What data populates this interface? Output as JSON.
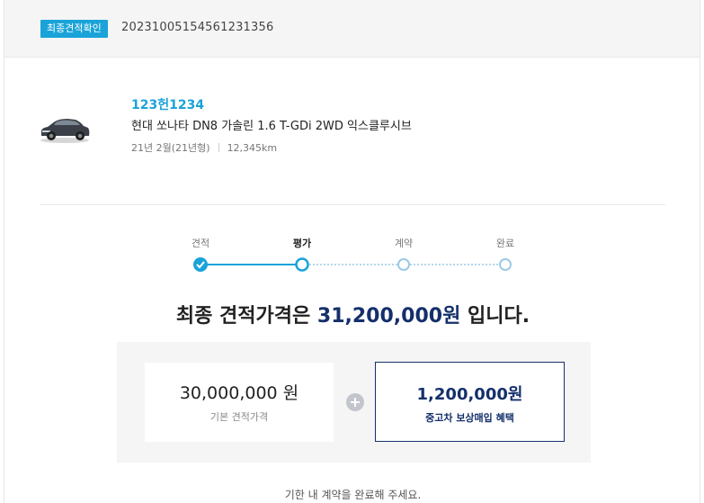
{
  "header": {
    "badge": "최종견적확인",
    "quote_number": "20231005154561231356"
  },
  "vehicle": {
    "plate": "123헌1234",
    "model": "현대 쏘나타 DN8 가솔린 1.6 T-GDi 2WD 익스클루시브",
    "year": "21년 2월(21년형)",
    "mileage": "12,345km",
    "image": "car-image"
  },
  "steps": [
    {
      "label": "견적",
      "state": "done"
    },
    {
      "label": "평가",
      "state": "current"
    },
    {
      "label": "계약",
      "state": "pending"
    },
    {
      "label": "완료",
      "state": "pending"
    }
  ],
  "final": {
    "prefix": "최종 견적가격은 ",
    "amount": "31,200,000원",
    "suffix": " 입니다."
  },
  "price": {
    "base_amount": "30,000,000 원",
    "base_label": "기본 견적가격",
    "bonus_amount": "1,200,000원",
    "bonus_label": "중고차 보상매입 혜택"
  },
  "notice": "기한 내 계약을 완료해 주세요.",
  "colors": {
    "accent": "#1aa3d9",
    "navy": "#14306b",
    "panel": "#f5f5f5"
  }
}
